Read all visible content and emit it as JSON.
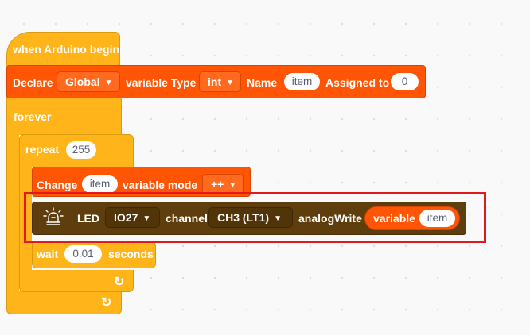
{
  "when_block": {
    "label": "when Arduino begin"
  },
  "declare_block": {
    "label": "Declare",
    "scope": "Global",
    "type_label": "variable Type",
    "type_value": "int",
    "name_label": "Name",
    "name_value": "item",
    "assigned_label": "Assigned to",
    "assigned_value": "0"
  },
  "forever_block": {
    "label": "forever"
  },
  "repeat_block": {
    "label": "repeat",
    "count": "255"
  },
  "change_block": {
    "label": "Change",
    "var": "item",
    "mode_label": "variable mode",
    "mode_value": "++"
  },
  "led_block": {
    "led_label": "LED",
    "pin": "IO27",
    "channel_label": "channel",
    "channel_value": "CH3 (LT1)",
    "write_label": "analogWrite",
    "variable_label": "variable",
    "variable_value": "item"
  },
  "wait_block": {
    "label": "wait",
    "value": "0.01",
    "unit": "seconds"
  },
  "loop_arrow": "↻",
  "highlight_color": "#e0191c"
}
